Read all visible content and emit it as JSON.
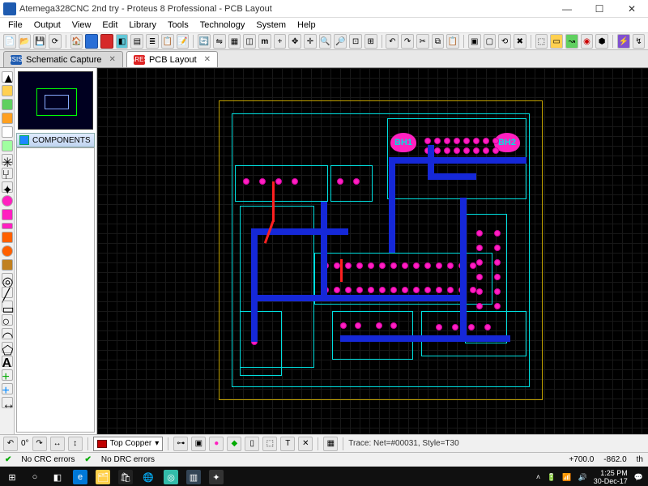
{
  "window": {
    "title": "Atemega328CNC 2nd try - Proteus 8 Professional - PCB Layout",
    "controls": {
      "min": "—",
      "max": "☐",
      "close": "✕"
    }
  },
  "menu": [
    "File",
    "Output",
    "View",
    "Edit",
    "Library",
    "Tools",
    "Technology",
    "System",
    "Help"
  ],
  "tabs": [
    {
      "label": "Schematic Capture",
      "badge_bg": "#1e5bb0",
      "badge_text": "ISIS",
      "active": false
    },
    {
      "label": "PCB Layout",
      "badge_bg": "#d22",
      "badge_text": "ARES",
      "active": true
    }
  ],
  "side": {
    "header": "COMPONENTS"
  },
  "layer": {
    "name": "Top Copper"
  },
  "statusbar": {
    "trace": "Trace: Net=#00031, Style=T30",
    "crc": "No CRC errors",
    "drc": "No DRC errors",
    "coord_x": "+700.0",
    "coord_y": "-862.0",
    "rot_label": "0°",
    "units": "th"
  },
  "pcb": {
    "labels": {
      "bh1": "BH1",
      "bh2": "BH2"
    }
  },
  "taskbar": {
    "time": "1:25 PM",
    "date": "30-Dec-17"
  }
}
